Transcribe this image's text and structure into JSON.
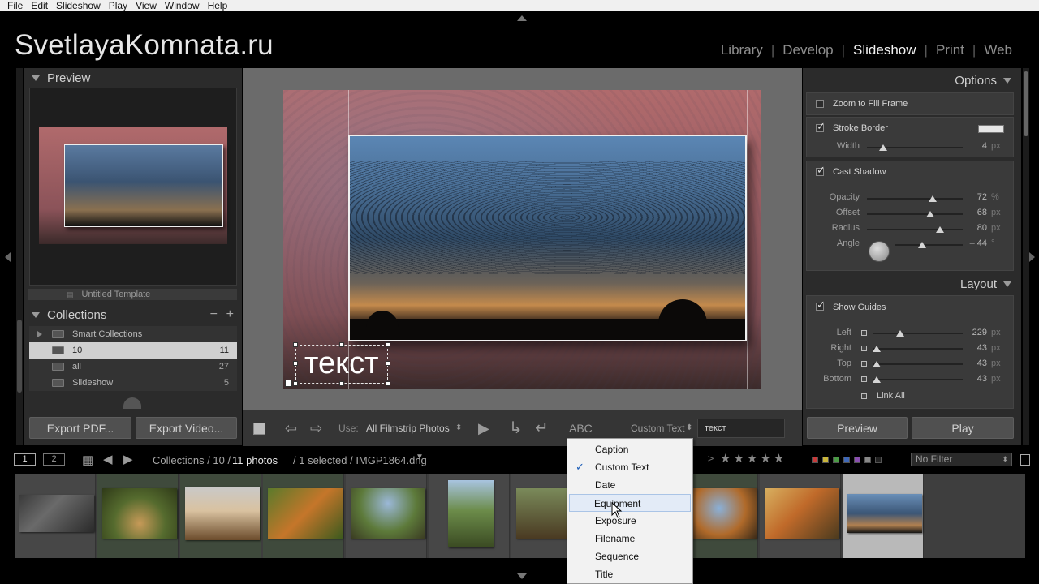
{
  "menu": [
    "File",
    "Edit",
    "Slideshow",
    "Play",
    "View",
    "Window",
    "Help"
  ],
  "brand": "SvetlayaKomnata.ru",
  "modules": [
    {
      "label": "Library",
      "active": false
    },
    {
      "label": "Develop",
      "active": false
    },
    {
      "label": "Slideshow",
      "active": true
    },
    {
      "label": "Print",
      "active": false
    },
    {
      "label": "Web",
      "active": false
    }
  ],
  "left_panel": {
    "preview_title": "Preview",
    "template_row": "Untitled Template",
    "collections_title": "Collections",
    "collections_minus": "−",
    "collections_plus": "+",
    "collections": [
      {
        "label": "Smart Collections",
        "count": ""
      },
      {
        "label": "10",
        "count": "11"
      },
      {
        "label": "all",
        "count": "27"
      },
      {
        "label": "Slideshow",
        "count": "5"
      }
    ],
    "export_pdf": "Export PDF...",
    "export_video": "Export Video..."
  },
  "slide": {
    "text_overlay": "текст"
  },
  "toolbar": {
    "use_label": "Use:",
    "use_value": "All Filmstrip Photos",
    "abc": "ABC",
    "text_source": "Custom Text",
    "custom_text_value": "текст"
  },
  "right_panel": {
    "options_title": "Options",
    "zoom_to_fill": {
      "label": "Zoom to Fill Frame",
      "checked": false
    },
    "stroke_border": {
      "label": "Stroke Border",
      "checked": true,
      "color": "#e6e6e6"
    },
    "width": {
      "label": "Width",
      "value": "4",
      "unit": "px",
      "fraction": 0.17
    },
    "cast_shadow": {
      "label": "Cast Shadow",
      "checked": true
    },
    "opacity": {
      "label": "Opacity",
      "value": "72",
      "unit": "%",
      "fraction": 0.69
    },
    "offset": {
      "label": "Offset",
      "value": "68",
      "unit": "px",
      "fraction": 0.66
    },
    "radius": {
      "label": "Radius",
      "value": "80",
      "unit": "px",
      "fraction": 0.76
    },
    "angle": {
      "label": "Angle",
      "value": "– 44",
      "unit": "°",
      "fraction": 0.4
    },
    "layout_title": "Layout",
    "show_guides": {
      "label": "Show Guides",
      "checked": true
    },
    "left": {
      "label": "Left",
      "value": "229",
      "unit": "px",
      "fraction": 0.3
    },
    "right": {
      "label": "Right",
      "value": "43",
      "unit": "px",
      "fraction": 0.04
    },
    "top": {
      "label": "Top",
      "value": "43",
      "unit": "px",
      "fraction": 0.04
    },
    "bottom": {
      "label": "Bottom",
      "value": "43",
      "unit": "px",
      "fraction": 0.04
    },
    "link_all": "Link All",
    "preview_btn": "Preview",
    "play_btn": "Play"
  },
  "filmbar": {
    "view1": "1",
    "view2": "2",
    "path_prefix": "Collections / 10 /",
    "photo_count": "11 photos",
    "selection": "/ 1 selected / IMGP1864.dng",
    "filter_icon": "≥",
    "filter_value": "No Filter"
  },
  "dropdown": {
    "items": [
      "Caption",
      "Custom Text",
      "Date",
      "Equipment",
      "Exposure",
      "Filename",
      "Sequence",
      "Title"
    ],
    "checked_index": 1,
    "highlight_index": 3,
    "check_mark": "✓"
  },
  "colors": {
    "label_red": "#c73a3a",
    "label_yellow": "#c9b53a",
    "label_green": "#4a9a45",
    "label_blue": "#3f68b8",
    "label_purple": "#8a4fb0"
  }
}
